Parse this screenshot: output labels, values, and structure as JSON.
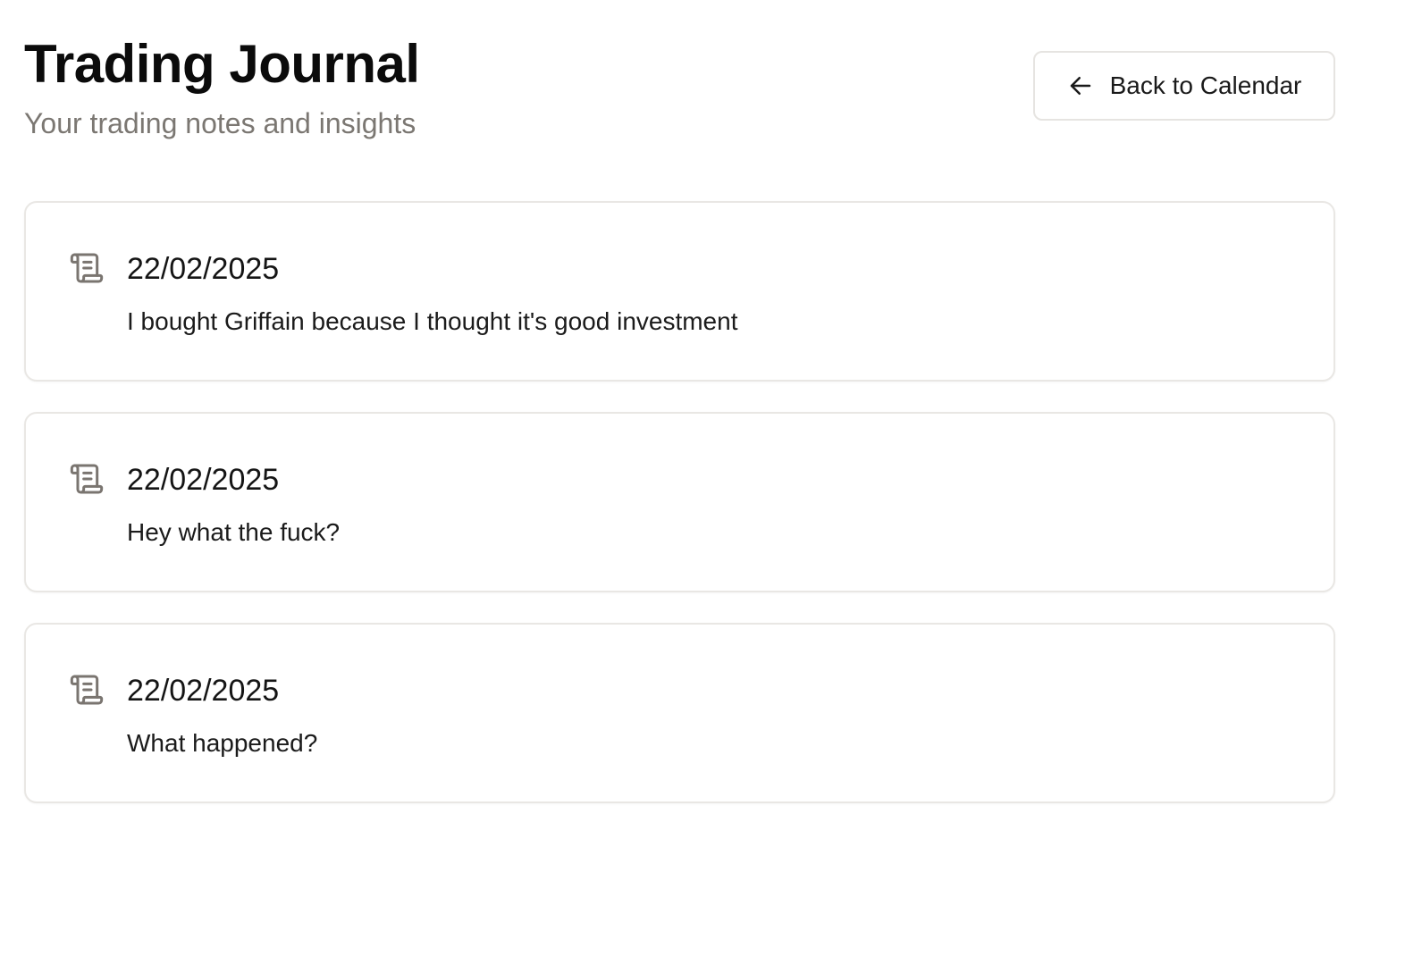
{
  "header": {
    "title": "Trading Journal",
    "subtitle": "Your trading notes and insights",
    "back_button_label": "Back to Calendar"
  },
  "icons": {
    "back": "arrow-left-icon",
    "entry": "scroll-icon"
  },
  "colors": {
    "subtitle": "#7b7772",
    "icon": "#7a7570",
    "border": "#e9e7e4"
  },
  "entries": [
    {
      "date": "22/02/2025",
      "text": "I bought Griffain because I thought it's good investment"
    },
    {
      "date": "22/02/2025",
      "text": "Hey what the fuck?"
    },
    {
      "date": "22/02/2025",
      "text": "What happened?"
    }
  ]
}
